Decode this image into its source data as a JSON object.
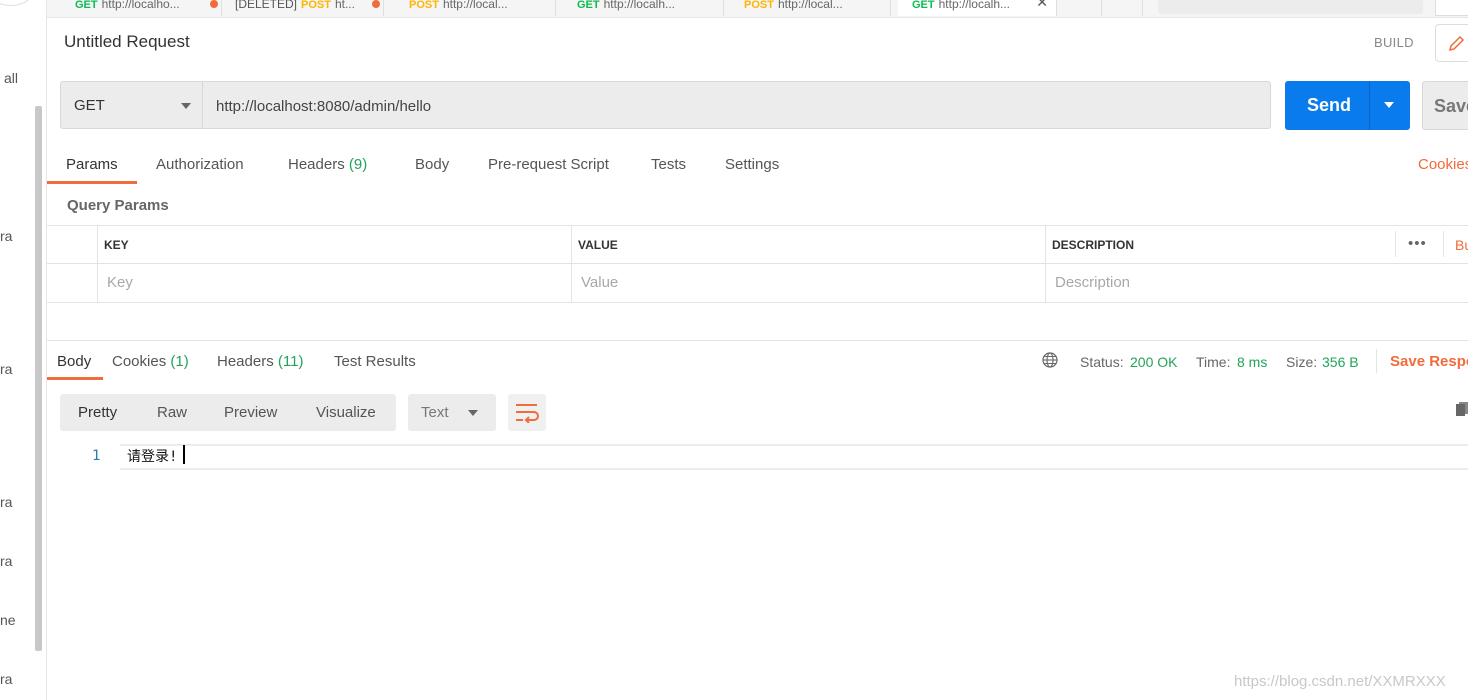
{
  "sidebar": {
    "view_all_fragment": "all",
    "item_fragments": [
      "ra",
      "ra",
      "ra",
      "ra",
      "ne",
      "ra"
    ]
  },
  "tabs": [
    {
      "method": "GET",
      "label": "http://localho...",
      "unsaved": true,
      "active": false
    },
    {
      "method": "POST",
      "prefix": "[DELETED]",
      "label": "ht...",
      "unsaved": true,
      "active": false
    },
    {
      "method": "POST",
      "label": "http://local...",
      "unsaved": false,
      "active": false
    },
    {
      "method": "GET",
      "label": "http://localh...",
      "unsaved": false,
      "active": false
    },
    {
      "method": "POST",
      "label": "http://local...",
      "unsaved": false,
      "active": false
    },
    {
      "method": "GET",
      "label": "http://localh...",
      "unsaved": false,
      "active": true
    }
  ],
  "request": {
    "title": "Untitled Request",
    "build_label": "BUILD",
    "method": "GET",
    "url": "http://localhost:8080/admin/hello",
    "send_label": "Send",
    "save_label": "Save"
  },
  "request_tabs": {
    "params": "Params",
    "authorization": "Authorization",
    "headers": "Headers",
    "headers_count": "(9)",
    "body": "Body",
    "prerequest": "Pre-request Script",
    "tests": "Tests",
    "settings": "Settings",
    "cookies_link": "Cookies"
  },
  "query_params": {
    "title": "Query Params",
    "columns": [
      "KEY",
      "VALUE",
      "DESCRIPTION"
    ],
    "placeholders": [
      "Key",
      "Value",
      "Description"
    ],
    "more_label": "•••",
    "bulk_edit_fragment": "Bu"
  },
  "response": {
    "tabs": {
      "body": "Body",
      "cookies": "Cookies",
      "cookies_count": "(1)",
      "headers": "Headers",
      "headers_count": "(11)",
      "test_results": "Test Results"
    },
    "status_label": "Status:",
    "status_value": "200 OK",
    "time_label": "Time:",
    "time_value": "8 ms",
    "size_label": "Size:",
    "size_value": "356 B",
    "save_response": "Save Respo",
    "views": [
      "Pretty",
      "Raw",
      "Preview",
      "Visualize"
    ],
    "format": "Text",
    "lines": [
      {
        "number": "1",
        "text": "请登录!"
      }
    ]
  },
  "watermark": "https://blog.csdn.net/XXMRXXX",
  "colors": {
    "accent": "#f26b3a",
    "send": "#097bed",
    "success": "#22a35a",
    "get": "#0cbb52",
    "post": "#ffb400"
  }
}
